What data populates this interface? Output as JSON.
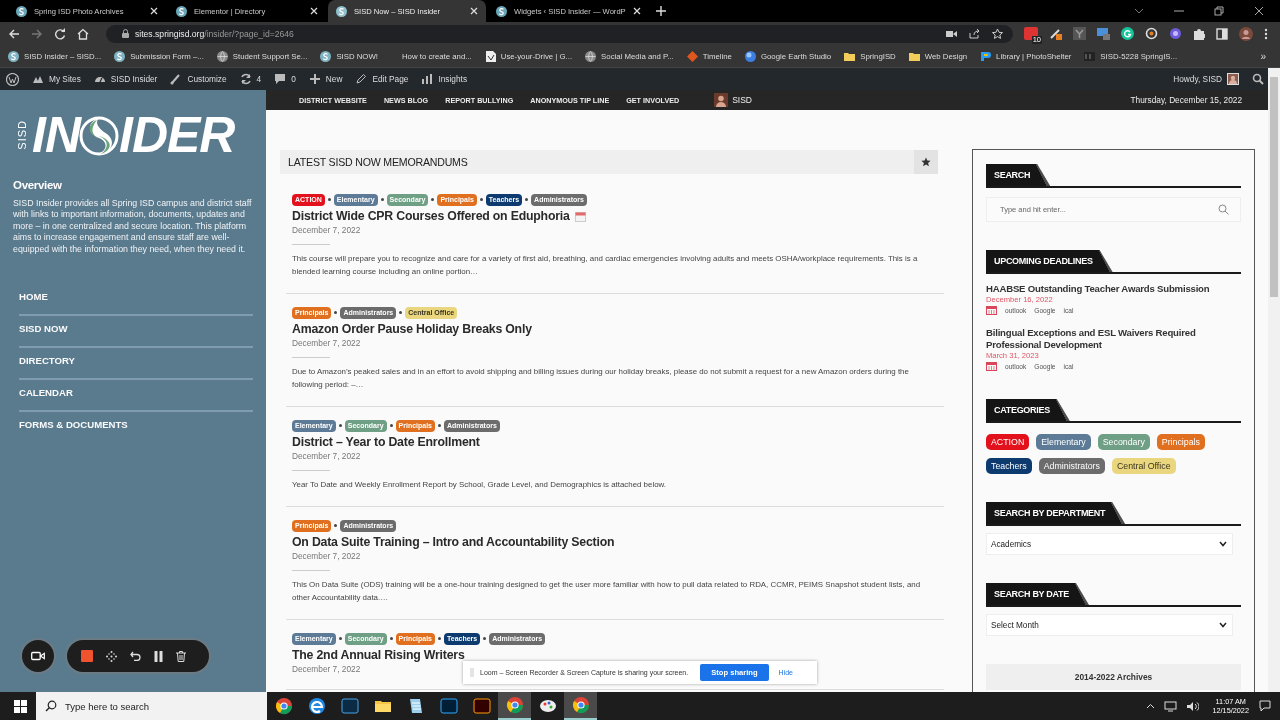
{
  "browser": {
    "tabs": [
      {
        "title": "Spring ISD Photo Archives",
        "selected": false
      },
      {
        "title": "Elementor | Directory",
        "selected": false
      },
      {
        "title": "SISD Now – SISD Insider",
        "selected": true
      },
      {
        "title": "Widgets ‹ SISD Insider — WordP",
        "selected": false
      }
    ],
    "url": {
      "host": "sites.springisd.org",
      "path": "/insider/?page_id=2646"
    },
    "extension_badge": "10",
    "bookmarks": [
      {
        "label": "SISD Insider – SISD...",
        "kind": "site"
      },
      {
        "label": "Submission Form –...",
        "kind": "site"
      },
      {
        "label": "Student Support Se...",
        "kind": "globe"
      },
      {
        "label": "SISD NOW!",
        "kind": "site"
      },
      {
        "label": "How to create and...",
        "kind": "blank"
      },
      {
        "label": "Use-your-Drive | G...",
        "kind": "doc"
      },
      {
        "label": "Social Media and P...",
        "kind": "globe"
      },
      {
        "label": "Timeline",
        "kind": "diamond"
      },
      {
        "label": "Google Earth Studio",
        "kind": "earth"
      },
      {
        "label": "SpringISD",
        "kind": "folder"
      },
      {
        "label": "Web Design",
        "kind": "folder"
      },
      {
        "label": "Library | PhotoShelter",
        "kind": "photo"
      },
      {
        "label": "SISD-5228 SpringIS...",
        "kind": "bb"
      }
    ],
    "bookmarks_overflow": "»"
  },
  "admin_bar": {
    "items": [
      {
        "label": "My Sites",
        "kind": "sites"
      },
      {
        "label": "SISD Insider",
        "kind": "dashboard"
      },
      {
        "label": "Customize",
        "kind": "brush"
      },
      {
        "label": "4",
        "kind": "updates"
      },
      {
        "label": "0",
        "kind": "comments"
      },
      {
        "label": "New",
        "kind": "plus"
      },
      {
        "label": "Edit Page",
        "kind": "pencil"
      },
      {
        "label": "Insights",
        "kind": "chart"
      }
    ],
    "greeting": "Howdy, SISD"
  },
  "top_nav": {
    "links": [
      "DISTRICT WEBSITE",
      "NEWS BLOG",
      "REPORT BULLYING",
      "ANONYMOUS TIP LINE",
      "GET INVOLVED"
    ],
    "user": "SISD",
    "date": "Thursday, December 15, 2022"
  },
  "sidebar": {
    "logo": {
      "side": "SISD",
      "start": "IN",
      "end": "IDER"
    },
    "heading": "Overview",
    "text": "SISD Insider provides all Spring ISD campus and district staff with links to important information, documents, updates and more – in one centralized and secure location. This platform aims to increase engagement and ensure staff are well-equipped with the information they need, when they need it.",
    "menu": [
      "HOME",
      "SISD NOW",
      "DIRECTORY",
      "CALENDAR",
      "FORMS & DOCUMENTS"
    ]
  },
  "memos": {
    "title": "LATEST SISD NOW MEMORANDUMS",
    "posts": [
      {
        "tags": [
          {
            "label": "ACTION",
            "color": "#e2111b"
          },
          {
            "label": "Elementary",
            "color": "#5d7b96"
          },
          {
            "label": "Secondary",
            "color": "#6f9f84"
          },
          {
            "label": "Principals",
            "color": "#e0701f"
          },
          {
            "label": "Teachers",
            "color": "#0e3b6f"
          },
          {
            "label": "Administrators",
            "color": "#6c6c6c"
          }
        ],
        "title": "District Wide CPR Courses Offered on Eduphoria",
        "event": true,
        "date": "December 7, 2022",
        "excerpt": "This course will prepare you to recognize and care for a variety of first aid, breathing, and cardiac emergencies involving adults and meets OSHA/workplace requirements. This is a blended learning course including an online portion…"
      },
      {
        "tags": [
          {
            "label": "Principals",
            "color": "#e0701f"
          },
          {
            "label": "Administrators",
            "color": "#6c6c6c"
          },
          {
            "label": "Central Office",
            "color": "#e9d67e"
          }
        ],
        "title": "Amazon Order Pause Holiday Breaks Only",
        "event": false,
        "date": "December 7, 2022",
        "excerpt": "Due to Amazon’s peaked sales and in an effort to avoid shipping and billing issues during our holiday breaks, please do not submit a request for a new Amazon orders during the following period: –…"
      },
      {
        "tags": [
          {
            "label": "Elementary",
            "color": "#5d7b96"
          },
          {
            "label": "Secondary",
            "color": "#6f9f84"
          },
          {
            "label": "Principals",
            "color": "#e0701f"
          },
          {
            "label": "Administrators",
            "color": "#6c6c6c"
          }
        ],
        "title": "District – Year to Date Enrollment",
        "event": false,
        "date": "December 7, 2022",
        "excerpt": "Year To Date and Weekly Enrollment Report by School, Grade Level, and Demographics is attached below."
      },
      {
        "tags": [
          {
            "label": "Principals",
            "color": "#e0701f"
          },
          {
            "label": "Administrators",
            "color": "#6c6c6c"
          }
        ],
        "title": "On Data Suite Training – Intro and Accountability Section",
        "event": false,
        "date": "December 7, 2022",
        "excerpt": "This On Data Suite (ODS) training will be a one-hour training designed to get the user more familiar with how to pull data related to RDA, CCMR, PEIMS Snapshot student lists, and other Accountability data.…"
      },
      {
        "tags": [
          {
            "label": "Elementary",
            "color": "#5d7b96"
          },
          {
            "label": "Secondary",
            "color": "#6f9f84"
          },
          {
            "label": "Principals",
            "color": "#e0701f"
          },
          {
            "label": "Teachers",
            "color": "#0e3b6f"
          },
          {
            "label": "Administrators",
            "color": "#6c6c6c"
          }
        ],
        "title": "The 2nd Annual Rising Writers",
        "event": false,
        "date": "December 7, 2022"
      }
    ]
  },
  "widgets": {
    "search": {
      "title": "SEARCH",
      "placeholder": "Type and hit enter..."
    },
    "deadlines": {
      "title": "UPCOMING DEADLINES",
      "items": [
        {
          "title": "HAABSE Outstanding Teacher Awards Submission",
          "date": "December 16, 2022",
          "links": [
            "outlook",
            "Google",
            "ical"
          ]
        },
        {
          "title": "Bilingual Exceptions and ESL Waivers Required Professional Development",
          "date": "March 31, 2023",
          "links": [
            "outlook",
            "Google",
            "ical"
          ]
        }
      ]
    },
    "categories": {
      "title": "CATEGORIES",
      "tags": [
        {
          "label": "ACTION",
          "color": "#e2111b"
        },
        {
          "label": "Elementary",
          "color": "#5d7b96"
        },
        {
          "label": "Secondary",
          "color": "#6f9f84"
        },
        {
          "label": "Principals",
          "color": "#e0701f"
        },
        {
          "label": "Teachers",
          "color": "#0e3b6f"
        },
        {
          "label": "Administrators",
          "color": "#6c6c6c"
        },
        {
          "label": "Central Office",
          "color": "#e9d67e"
        }
      ]
    },
    "department": {
      "title": "SEARCH BY DEPARTMENT",
      "value": "Academics"
    },
    "by_date": {
      "title": "SEARCH BY DATE",
      "value": "Select Month"
    },
    "archives": "2014-2022 Archives"
  },
  "loom": {
    "message": "Loom – Screen Recorder & Screen Capture is sharing your screen.",
    "stop": "Stop sharing",
    "hide": "Hide"
  },
  "taskbar": {
    "search_placeholder": "Type here to search",
    "apps": [
      {
        "kind": "chrome",
        "active": false
      },
      {
        "kind": "edge",
        "active": false
      },
      {
        "kind": "lrc",
        "active": false
      },
      {
        "kind": "folder",
        "active": false
      },
      {
        "kind": "notes",
        "active": false
      },
      {
        "kind": "ps",
        "active": false
      },
      {
        "kind": "ai",
        "active": false
      },
      {
        "kind": "chrome",
        "active": true
      },
      {
        "kind": "paint",
        "active": false
      },
      {
        "kind": "chrome",
        "active": true
      }
    ],
    "time": "11:07 AM",
    "date": "12/15/2022"
  }
}
